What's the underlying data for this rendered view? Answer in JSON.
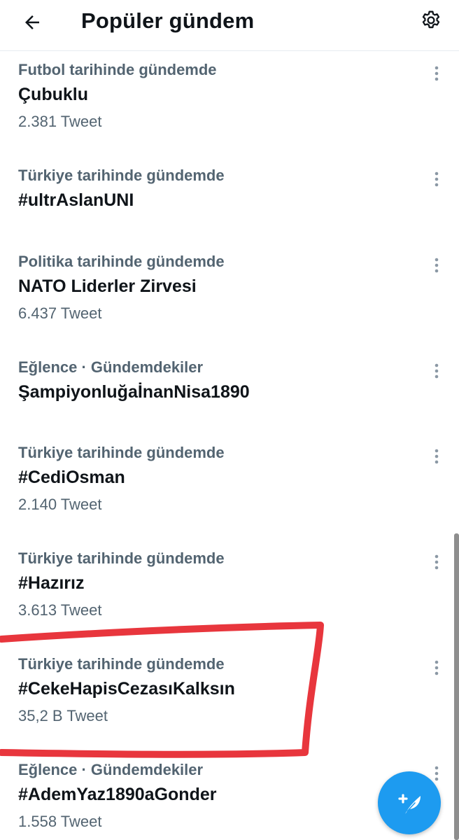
{
  "header": {
    "title": "Popüler gündem",
    "back_icon": "arrow-left-icon",
    "settings_icon": "gear-icon"
  },
  "trends": [
    {
      "context": "Futbol tarihinde gündemde",
      "name": "Çubuklu",
      "count": "2.381 Tweet"
    },
    {
      "context": "Türkiye tarihinde gündemde",
      "name": "#ultrAslanUNI",
      "count": ""
    },
    {
      "context": "Politika tarihinde gündemde",
      "name": "NATO Liderler Zirvesi",
      "count": "6.437 Tweet"
    },
    {
      "context": "Eğlence · Gündemdekiler",
      "name": "ŞampiyonluğaİnanNisa1890",
      "count": ""
    },
    {
      "context": "Türkiye tarihinde gündemde",
      "name": "#CediOsman",
      "count": "2.140 Tweet"
    },
    {
      "context": "Türkiye tarihinde gündemde",
      "name": "#Hazırız",
      "count": "3.613 Tweet"
    },
    {
      "context": "Türkiye tarihinde gündemde",
      "name": "#CekeHapisCezasıKalksın",
      "count": "35,2 B Tweet"
    },
    {
      "context": "Eğlence · Gündemdekiler",
      "name": "#AdemYaz1890aGonder",
      "count": "1.558 Tweet"
    }
  ],
  "more_icon": "more-vertical-icon",
  "compose_icon": "compose-tweet-icon",
  "colors": {
    "accent": "#1d9bf0",
    "secondary_text": "#536471",
    "primary_text": "#0f1419",
    "highlight": "#e8363d"
  }
}
